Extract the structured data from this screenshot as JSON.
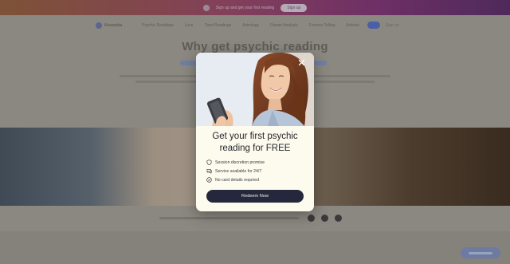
{
  "promo": {
    "text": "Sign up and get your first reading",
    "button_label": "Sign up"
  },
  "nav": {
    "logo_text": "Kasamba",
    "links": [
      "Psychic Readings",
      "Love",
      "Tarot Readings",
      "Astrology",
      "Dream Analysis",
      "Fortune Telling",
      "Articles"
    ],
    "signup_label": "Sign up"
  },
  "hero": {
    "title": "Why get psychic reading"
  },
  "modal": {
    "close_icon": "close-icon",
    "title_line1": "Get your first psychic",
    "title_line2": "reading for FREE",
    "features": [
      {
        "icon": "shield-icon",
        "text": "Session discretion promise"
      },
      {
        "icon": "chat-icon",
        "text": "Service available for 24/7"
      },
      {
        "icon": "check-circle-icon",
        "text": "No card details required"
      }
    ],
    "cta_label": "Redeem Now"
  },
  "colors": {
    "overlay": "#8a8880",
    "modal_bg": "#fcfbee",
    "cta_bg": "#25283c",
    "promo_gradient_start": "#7e5237",
    "promo_gradient_end": "#4e2a5a"
  }
}
